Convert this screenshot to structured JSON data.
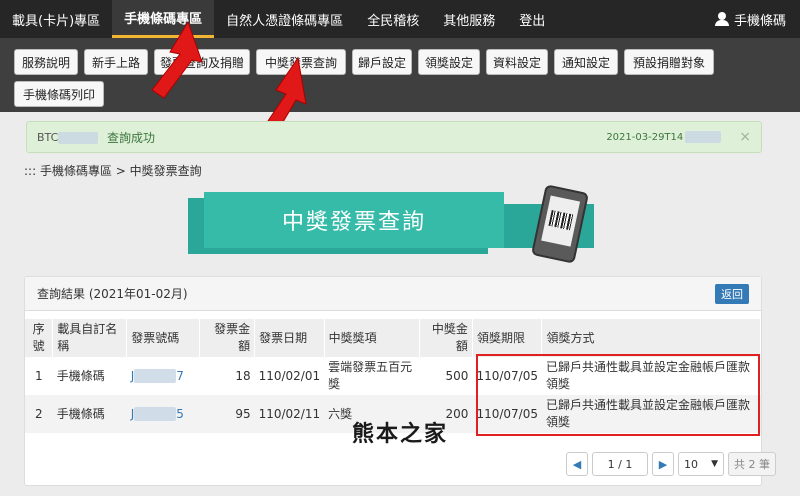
{
  "topnav": {
    "items": [
      "載具(卡片)專區",
      "手機條碼專區",
      "自然人憑證條碼專區",
      "全民稽核",
      "其他服務",
      "登出"
    ],
    "active_index": 1,
    "user_label": "手機條碼",
    "user_icon": "user-icon"
  },
  "subnav": {
    "buttons": [
      "服務說明",
      "新手上路",
      "發票查詢及捐贈",
      "中獎發票查詢",
      "歸戶設定",
      "領獎設定",
      "資料設定",
      "通知設定",
      "預設捐贈對象",
      "手機條碼列印"
    ]
  },
  "alert": {
    "code_prefix": "BTC",
    "message": "查詢成功",
    "time_prefix": "2021-03-29T14",
    "close": "×"
  },
  "breadcrumb": "::: 手機條碼專區 > 中獎發票查詢",
  "banner_title": "中獎發票查詢",
  "results": {
    "title": "查詢結果 (2021年01-02月)",
    "back_label": "返回",
    "headers": [
      "序號",
      "載具自訂名稱",
      "發票號碼",
      "發票金額",
      "發票日期",
      "中獎獎項",
      "中獎金額",
      "領獎期限",
      "領獎方式"
    ],
    "rows": [
      {
        "no": "1",
        "name": "手機條碼",
        "inv_prefix": "J",
        "inv_suffix": "7",
        "amount": "18",
        "date": "110/02/01",
        "prize": "雲端發票五百元獎",
        "prize_amount": "500",
        "deadline": "110/07/05",
        "method": "已歸戶共通性載具並設定金融帳戶匯款領獎"
      },
      {
        "no": "2",
        "name": "手機條碼",
        "inv_prefix": "J",
        "inv_suffix": "5",
        "amount": "95",
        "date": "110/02/11",
        "prize": "六獎",
        "prize_amount": "200",
        "deadline": "110/07/05",
        "method": "已歸戶共通性載具並設定金融帳戶匯款領獎"
      }
    ]
  },
  "pager": {
    "page": "1 / 1",
    "page_size": "10",
    "total": "共 2 筆"
  },
  "watermark": "熊本之家"
}
